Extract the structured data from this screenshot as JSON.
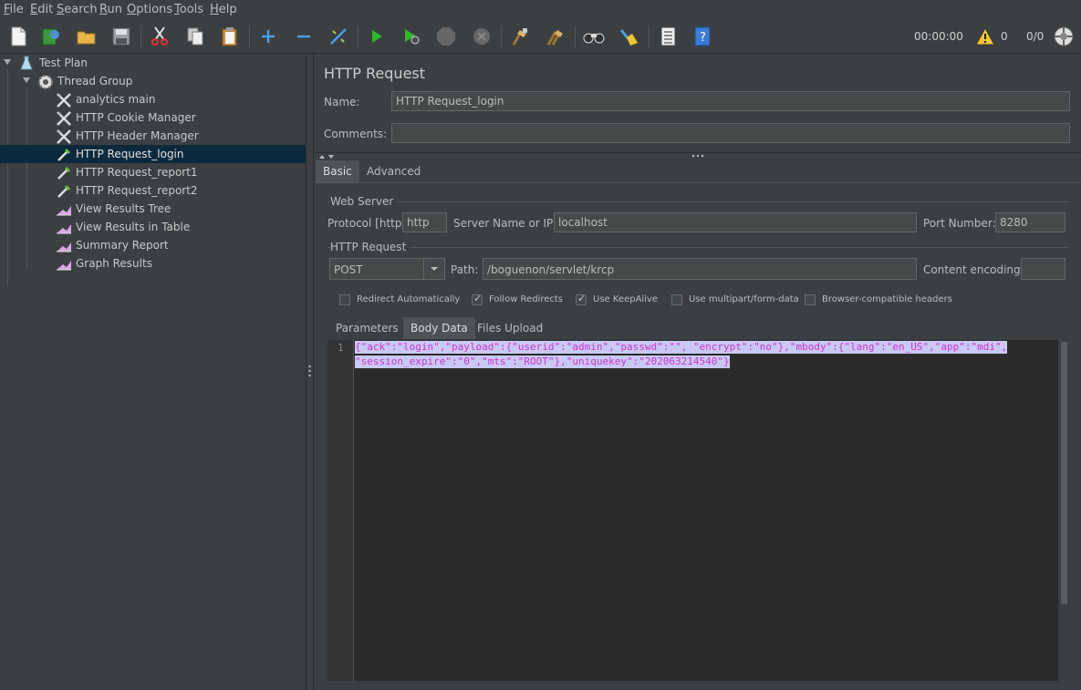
{
  "menu": {
    "items": [
      {
        "label": "File",
        "mnemonic": "F",
        "rest": "ile"
      },
      {
        "label": "Edit",
        "mnemonic": "E",
        "rest": "dit"
      },
      {
        "label": "Search",
        "mnemonic": "S",
        "rest": "earch"
      },
      {
        "label": "Run",
        "mnemonic": "R",
        "rest": "un"
      },
      {
        "label": "Options",
        "mnemonic": "O",
        "rest": "ptions"
      },
      {
        "label": "Tools",
        "mnemonic": "T",
        "rest": "ools"
      },
      {
        "label": "Help",
        "mnemonic": "H",
        "rest": "elp"
      }
    ]
  },
  "toolbar": {
    "timer": "00:00:00",
    "warning_count": "0",
    "thread_count": "0/0",
    "icons": [
      "new-icon",
      "templates-icon",
      "open-icon",
      "save-icon",
      "cut-icon",
      "copy-icon",
      "paste-icon",
      "expand-icon",
      "collapse-icon",
      "toggle-icon",
      "start-icon",
      "start-no-pause-icon",
      "stop-icon",
      "shutdown-icon",
      "clear-icon",
      "clear-all-icon",
      "search-icon",
      "reset-search-icon",
      "function-helper-icon",
      "help-icon"
    ]
  },
  "tree": {
    "items": [
      {
        "label": "Test Plan",
        "icon": "test-plan-icon"
      },
      {
        "label": "Thread Group",
        "icon": "gear-icon"
      },
      {
        "label": "analytics main",
        "icon": "config-element-icon"
      },
      {
        "label": "HTTP Cookie Manager",
        "icon": "config-element-icon"
      },
      {
        "label": "HTTP Header Manager",
        "icon": "config-element-icon"
      },
      {
        "label": "HTTP Request_login",
        "icon": "sampler-icon"
      },
      {
        "label": "HTTP Request_report1",
        "icon": "sampler-icon"
      },
      {
        "label": "HTTP Request_report2",
        "icon": "sampler-icon"
      },
      {
        "label": "View Results Tree",
        "icon": "listener-icon"
      },
      {
        "label": "View Results in Table",
        "icon": "listener-icon"
      },
      {
        "label": "Summary Report",
        "icon": "listener-icon"
      },
      {
        "label": "Graph Results",
        "icon": "listener-icon"
      }
    ]
  },
  "panel": {
    "title": "HTTP Request",
    "name_label": "Name:",
    "name_value": "HTTP Request_login",
    "comments_label": "Comments:",
    "comments_value": "",
    "tabs": [
      {
        "label": "Basic"
      },
      {
        "label": "Advanced"
      }
    ],
    "web_server": {
      "group_label": "Web Server",
      "protocol_label": "Protocol [http]:",
      "protocol_value": "http",
      "server_label": "Server Name or IP:",
      "server_value": "localhost",
      "port_label": "Port Number:",
      "port_value": "8280"
    },
    "http_request": {
      "group_label": "HTTP Request",
      "method_value": "POST",
      "path_label": "Path:",
      "path_value": "/boguenon/servlet/krcp",
      "encoding_label": "Content encoding:",
      "encoding_value": ""
    },
    "checkboxes": [
      {
        "label": "Redirect Automatically",
        "checked": false
      },
      {
        "label": "Follow Redirects",
        "checked": true
      },
      {
        "label": "Use KeepAlive",
        "checked": true
      },
      {
        "label": "Use multipart/form-data",
        "checked": false
      },
      {
        "label": "Browser-compatible headers",
        "checked": false
      }
    ],
    "body_tabs": [
      {
        "label": "Parameters"
      },
      {
        "label": "Body Data"
      },
      {
        "label": "Files Upload"
      }
    ],
    "line_number": "1",
    "body_lines": [
      "{\"ack\":\"login\",\"payload\":{\"userid\":\"admin\",\"passwd\":\"\", \"encrypt\":\"no\"},\"mbody\":{\"lang\":\"en_US\",\"app\":\"mdi\",",
      "\"session_expire\":\"0\",\"mts\":\"ROOT\"},\"uniquekey\":\"202063214540\"}"
    ]
  },
  "colors": {
    "background": "#3c3f41",
    "selection": "#0d293e",
    "code_text": "#cc33cc",
    "code_highlight": "#c9c9f5"
  }
}
